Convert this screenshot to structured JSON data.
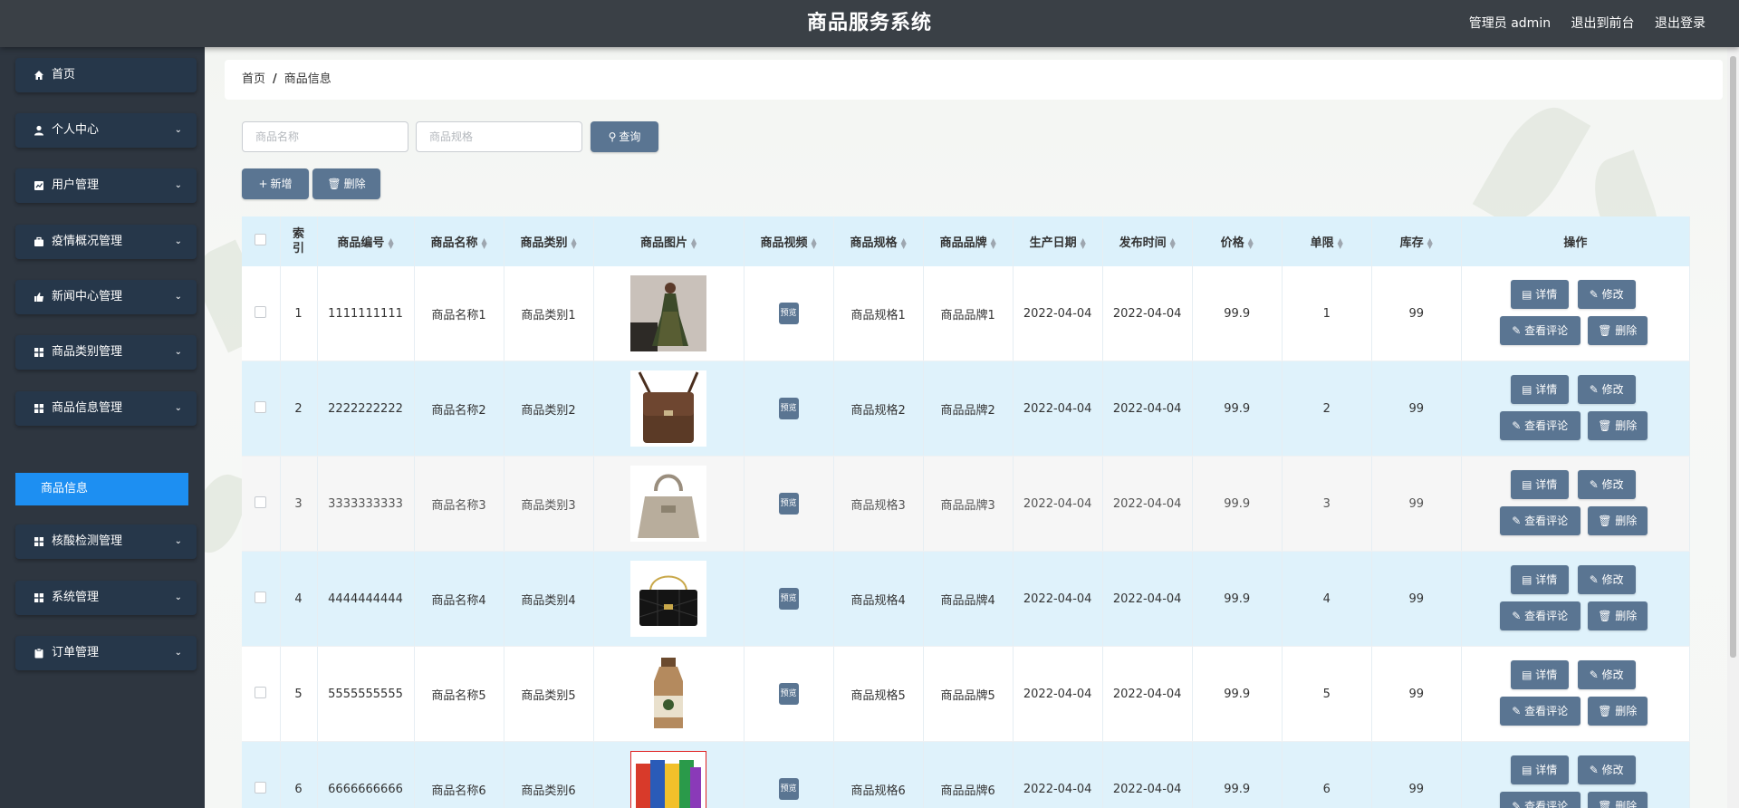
{
  "header": {
    "title": "商品服务系统",
    "user": "管理员 admin",
    "back_front": "退出到前台",
    "logout": "退出登录"
  },
  "sidebar": {
    "items": [
      {
        "label": "首页",
        "icon": "home-icon",
        "expandable": false
      },
      {
        "label": "个人中心",
        "icon": "user-icon",
        "expandable": true
      },
      {
        "label": "用户管理",
        "icon": "chart-icon",
        "expandable": true
      },
      {
        "label": "疫情概况管理",
        "icon": "briefcase-icon",
        "expandable": true
      },
      {
        "label": "新闻中心管理",
        "icon": "thumb-icon",
        "expandable": true
      },
      {
        "label": "商品类别管理",
        "icon": "grid-icon",
        "expandable": true
      },
      {
        "label": "商品信息管理",
        "icon": "grid-icon",
        "expandable": true
      },
      {
        "label": "核酸检测管理",
        "icon": "grid-icon",
        "expandable": true
      },
      {
        "label": "系统管理",
        "icon": "grid-icon",
        "expandable": true
      },
      {
        "label": "订单管理",
        "icon": "clipboard-icon",
        "expandable": true
      }
    ],
    "active_sub": "商品信息"
  },
  "breadcrumb": {
    "home": "首页",
    "separator": "/",
    "current": "商品信息"
  },
  "search": {
    "name_placeholder": "商品名称",
    "spec_placeholder": "商品规格",
    "query_label": "查询"
  },
  "actions": {
    "add_label": "新增",
    "delete_label": "删除"
  },
  "table": {
    "headers": [
      "索引",
      "商品编号",
      "商品名称",
      "商品类别",
      "商品图片",
      "商品视频",
      "商品规格",
      "商品品牌",
      "生产日期",
      "发布时间",
      "价格",
      "单限",
      "库存",
      "操作"
    ],
    "preview_label": "预览",
    "op_labels": {
      "detail": "详情",
      "edit": "修改",
      "comments": "查看评论",
      "delete": "删除"
    },
    "rows": [
      {
        "index": "1",
        "code": "1111111111",
        "name": "商品名称1",
        "category": "商品类别1",
        "image": "dress-photo",
        "spec": "商品规格1",
        "brand": "商品品牌1",
        "prod_date": "2022-04-04",
        "pub_date": "2022-04-04",
        "price": "99.9",
        "limit": "1",
        "stock": "99"
      },
      {
        "index": "2",
        "code": "2222222222",
        "name": "商品名称2",
        "category": "商品类别2",
        "image": "messenger-bag-photo",
        "spec": "商品规格2",
        "brand": "商品品牌2",
        "prod_date": "2022-04-04",
        "pub_date": "2022-04-04",
        "price": "99.9",
        "limit": "2",
        "stock": "99"
      },
      {
        "index": "3",
        "code": "3333333333",
        "name": "商品名称3",
        "category": "商品类别3",
        "image": "handbag-photo",
        "spec": "商品规格3",
        "brand": "商品品牌3",
        "prod_date": "2022-04-04",
        "pub_date": "2022-04-04",
        "price": "99.9",
        "limit": "3",
        "stock": "99"
      },
      {
        "index": "4",
        "code": "4444444444",
        "name": "商品名称4",
        "category": "商品类别4",
        "image": "quilted-bag-photo",
        "spec": "商品规格4",
        "brand": "商品品牌4",
        "prod_date": "2022-04-04",
        "pub_date": "2022-04-04",
        "price": "99.9",
        "limit": "4",
        "stock": "99"
      },
      {
        "index": "5",
        "code": "5555555555",
        "name": "商品名称5",
        "category": "商品类别5",
        "image": "milk-tea-bottle-photo",
        "spec": "商品规格5",
        "brand": "商品品牌5",
        "prod_date": "2022-04-04",
        "pub_date": "2022-04-04",
        "price": "99.9",
        "limit": "5",
        "stock": "99"
      },
      {
        "index": "6",
        "code": "6666666666",
        "name": "商品名称6",
        "category": "商品类别6",
        "image": "snack-pack-photo",
        "spec": "商品规格6",
        "brand": "商品品牌6",
        "prod_date": "2022-04-04",
        "pub_date": "2022-04-04",
        "price": "99.9",
        "limit": "6",
        "stock": "99"
      }
    ]
  },
  "colors": {
    "header_bg": "#3a4046",
    "sidebar_bg": "#2e3640",
    "menu_bg": "#26374a",
    "active_bg": "#1d8ff2",
    "button_bg": "#5a7592",
    "row_blue": "#dff2fb"
  }
}
